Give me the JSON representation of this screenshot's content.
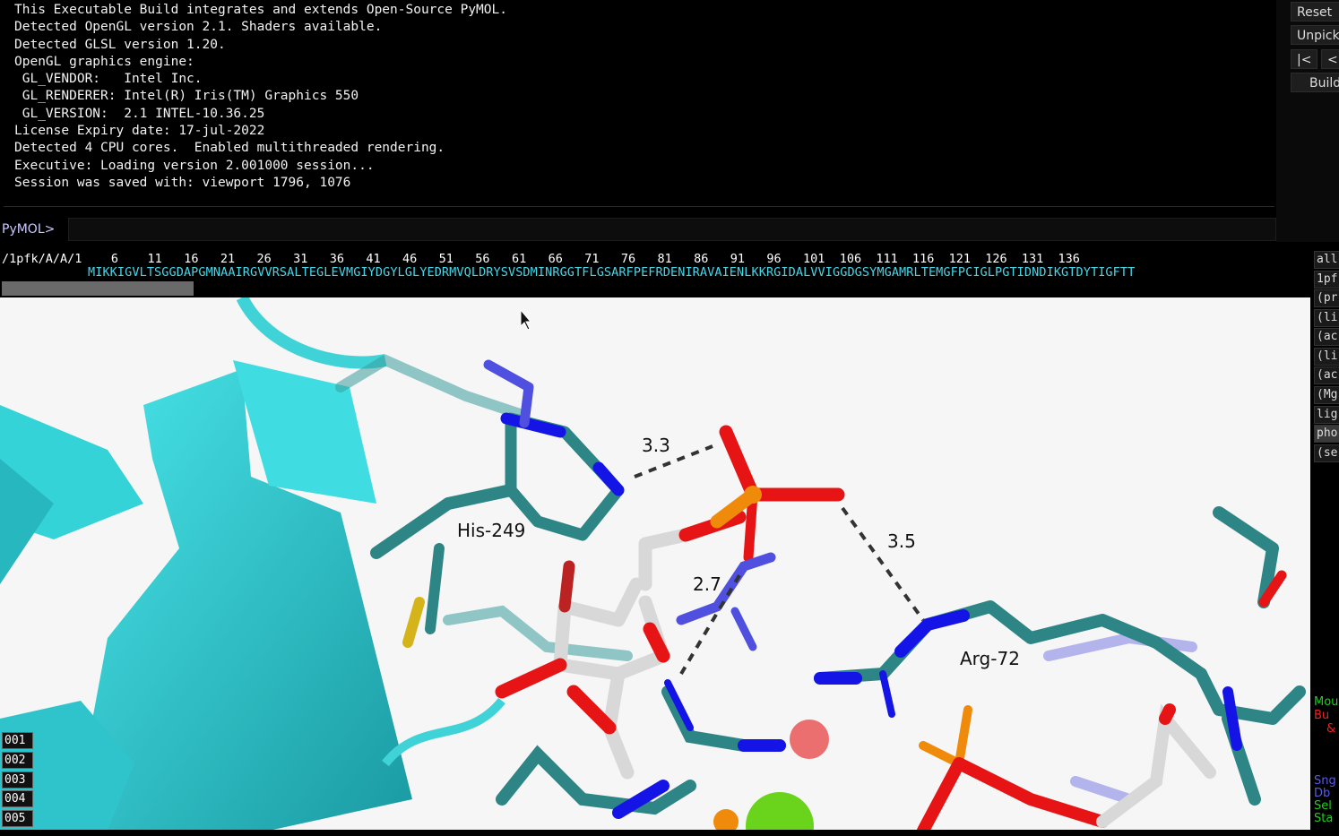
{
  "log": {
    "lines": [
      "This Executable Build integrates and extends Open-Source PyMOL.",
      "Detected OpenGL version 2.1. Shaders available.",
      "Detected GLSL version 1.20.",
      "OpenGL graphics engine:",
      " GL_VENDOR:   Intel Inc.",
      " GL_RENDERER: Intel(R) Iris(TM) Graphics 550",
      " GL_VERSION:  2.1 INTEL-10.36.25",
      "License Expiry date: 17-jul-2022",
      "Detected 4 CPU cores.  Enabled multithreaded rendering.",
      "Executive: Loading version 2.001000 session...",
      "Session was saved with: viewport 1796, 1076"
    ]
  },
  "command": {
    "prompt": "PyMOL>",
    "value": ""
  },
  "right_buttons": {
    "reset": "Reset",
    "unpick": "Unpick",
    "first": "|<",
    "prev": "<",
    "build": "Build"
  },
  "sequence": {
    "chain_label": "/1pfk/A/A/",
    "numbers": "1    6    11   16   21   26   31   36   41   46   51   56   61   66   71   76   81   86   91   96   101  106  111  116  121  126  131  136",
    "residues": "MIKKIGVLTSGGDAPGMNAAIRGVVRSALTEGLEVMGIYDGYLGLYEDRMVQLDRYSVSDMINRGGTFLGSARFPEFRDENIRAVAIENLKKRGIDALVVIGGDGSYMGAMRLTEMGFPCIGLPGTIDNDIKGTDYTIGFTT"
  },
  "viewer": {
    "labels": {
      "his": "His-249",
      "arg": "Arg-72"
    },
    "distances": {
      "d1": "3.3",
      "d2": "3.5",
      "d3": "2.7"
    },
    "colors": {
      "carbon_protein": "#2e8585",
      "carbon_ligand": "#d8d8d8",
      "nitrogen": "#1414e6",
      "oxygen": "#e61414",
      "phosphorus": "#f08a0a",
      "sulfur": "#d4b418",
      "cartoon": "#2ad0d6",
      "magnesium": "#6ad41c"
    }
  },
  "objects": [
    "all",
    "1pf",
    "(pr",
    "(li",
    "(ac",
    "(li",
    "(ac",
    "(Mg",
    "lig",
    "pho",
    "(se"
  ],
  "scenes": [
    "001",
    "002",
    "003",
    "004",
    "005"
  ],
  "mouse_info": {
    "l1": "Mou",
    "l2": "Bu",
    "l3": "&",
    "l4": "Sng",
    "l5": "Db",
    "l6": "Sel",
    "l7": "Sta"
  }
}
